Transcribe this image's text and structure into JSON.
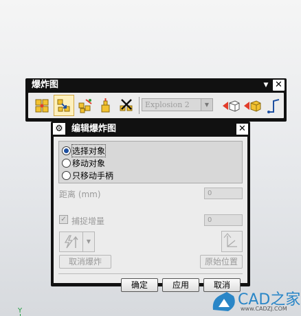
{
  "toolbar": {
    "title": "爆炸图",
    "caret": "▼",
    "close": "✕",
    "select_value": "Explosion 2",
    "select_arrow": "▼",
    "buttons": [
      {
        "icon": "new-explosion-icon"
      },
      {
        "icon": "edit-explosion-icon"
      },
      {
        "icon": "auto-explode-icon"
      },
      {
        "icon": "unexplode-icon"
      },
      {
        "icon": "delete-explosion-icon"
      },
      {
        "icon": "hide-in-view-icon"
      },
      {
        "icon": "show-in-view-icon"
      },
      {
        "icon": "tracelines-icon"
      }
    ]
  },
  "dialog": {
    "title": "编辑爆炸图",
    "gear": "⚙",
    "close": "✕",
    "options": [
      {
        "label": "选择对象",
        "selected": true
      },
      {
        "label": "移动对象",
        "selected": false
      },
      {
        "label": "只移动手柄",
        "selected": false
      }
    ],
    "distance_label": "距离 (mm)",
    "distance_value": "0",
    "snap_label": "捕捉增量",
    "snap_checked": "✓",
    "snap_value": "0",
    "split_arrow": "▼",
    "cancel_explode": "取消爆炸",
    "original_position": "原始位置",
    "ok": "确定",
    "apply": "应用",
    "cancel": "取消"
  },
  "watermark": {
    "brand": "CAD之家",
    "url": "www.CADZJ.COM"
  },
  "axis": {
    "y_label": "Y"
  },
  "colors": {
    "titlebar": "#111111",
    "panel": "#ececec",
    "radio_selected": "#1d4fa0",
    "brand": "#2a86c7"
  }
}
